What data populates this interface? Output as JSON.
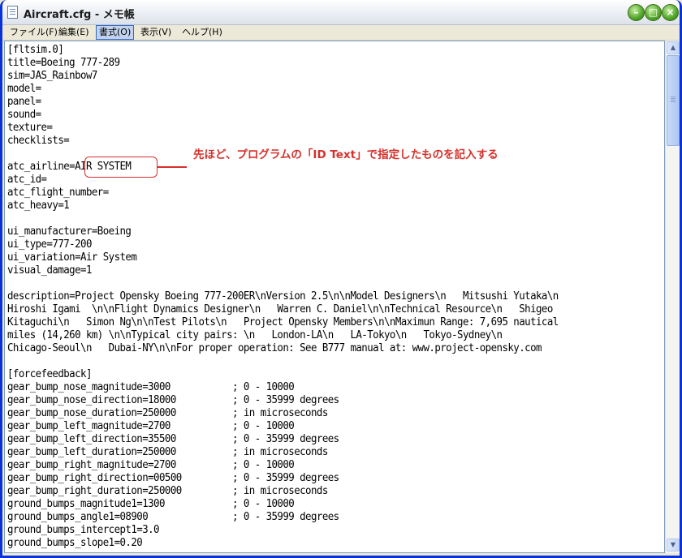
{
  "window": {
    "title": "Aircraft.cfg - メモ帳",
    "buttons": {
      "minimize": "–",
      "maximize": "□",
      "close": "×"
    }
  },
  "menu": [
    {
      "label": "ファイル(F)",
      "active": false
    },
    {
      "label": "編集(E)",
      "active": false
    },
    {
      "label": "書式(O)",
      "active": true
    },
    {
      "label": "表示(V)",
      "active": false
    },
    {
      "label": "ヘルプ(H)",
      "active": false
    }
  ],
  "editor": {
    "lines": [
      "[fltsim.0]",
      "title=Boeing 777-289",
      "sim=JAS_Rainbow7",
      "model=",
      "panel=",
      "sound=",
      "texture=",
      "checklists=",
      "",
      "atc_airline=AIR SYSTEM",
      "atc_id=",
      "atc_flight_number=",
      "atc_heavy=1",
      "",
      "ui_manufacturer=Boeing",
      "ui_type=777-200",
      "ui_variation=Air System",
      "visual_damage=1",
      "",
      "description=Project Opensky Boeing 777-200ER\\nVersion 2.5\\n\\nModel Designers\\n   Mitsushi Yutaka\\n",
      "Hiroshi Igami  \\n\\nFlight Dynamics Designer\\n   Warren C. Daniel\\n\\nTechnical Resource\\n   Shigeo",
      "Kitaguchi\\n   Simon Ng\\n\\nTest Pilots\\n   Project Opensky Members\\n\\nMaximun Range: 7,695 nautical",
      "miles (14,260 km) \\n\\nTypical city pairs: \\n   London-LA\\n   LA-Tokyo\\n   Tokyo-Sydney\\n",
      "Chicago-Seoul\\n   Dubai-NY\\n\\nFor proper operation: See B777 manual at: www.project-opensky.com",
      "",
      "[forcefeedback]",
      "gear_bump_nose_magnitude=3000           ; 0 - 10000",
      "gear_bump_nose_direction=18000          ; 0 - 35999 degrees",
      "gear_bump_nose_duration=250000          ; in microseconds",
      "gear_bump_left_magnitude=2700           ; 0 - 10000",
      "gear_bump_left_direction=35500          ; 0 - 35999 degrees",
      "gear_bump_left_duration=250000          ; in microseconds",
      "gear_bump_right_magnitude=2700          ; 0 - 10000",
      "gear_bump_right_direction=00500         ; 0 - 35999 degrees",
      "gear_bump_right_duration=250000         ; in microseconds",
      "ground_bumps_magnitude1=1300            ; 0 - 10000",
      "ground_bumps_angle1=08900               ; 0 - 35999 degrees",
      "ground_bumps_intercept1=3.0",
      "ground_bumps_slope1=0.20"
    ]
  },
  "annotation": {
    "text": "先ほど、プログラムの「ID Text」で指定したものを記入する",
    "color": "#d6312b"
  },
  "scrollbar": {
    "up": "▲",
    "down": "▼"
  }
}
